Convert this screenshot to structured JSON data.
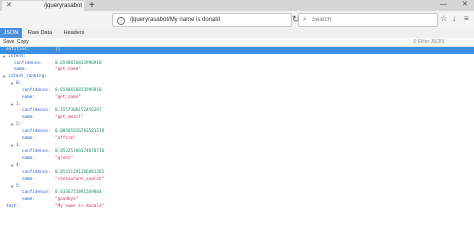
{
  "browser": {
    "tab_title": "/jqueryrasabot/",
    "url": "/jqueryrasabot/My name is donald",
    "search_placeholder": "Search"
  },
  "viewer": {
    "tabs": [
      "JSON",
      "Raw Data",
      "Headers"
    ],
    "save_label": "Save",
    "copy_label": "Copy",
    "filter_label": "Filter JSON"
  },
  "json_rows": [
    {
      "key": "entities:",
      "value": "[]",
      "indent": 0,
      "arrow": false,
      "type": "str",
      "selected": true
    },
    {
      "key": "intent:",
      "value": "",
      "indent": 0,
      "arrow": true,
      "type": "str"
    },
    {
      "key": "confidence:",
      "value": "0.6540656833996918",
      "indent": 1,
      "arrow": false,
      "type": "num"
    },
    {
      "key": "name:",
      "value": "\"get_name\"",
      "indent": 1,
      "arrow": false,
      "type": "str"
    },
    {
      "key": "intent_ranking:",
      "value": "",
      "indent": 0,
      "arrow": true,
      "type": "str"
    },
    {
      "key": "0:",
      "value": "",
      "indent": 1,
      "arrow": true,
      "type": "str"
    },
    {
      "key": "confidence:",
      "value": "0.6540656833996918",
      "indent": 2,
      "arrow": false,
      "type": "num"
    },
    {
      "key": "name:",
      "value": "\"get_name\"",
      "indent": 2,
      "arrow": false,
      "type": "str"
    },
    {
      "key": "1:",
      "value": "",
      "indent": 1,
      "arrow": true,
      "type": "str"
    },
    {
      "key": "confidence:",
      "value": "0.1557308152456367",
      "indent": 2,
      "arrow": false,
      "type": "num"
    },
    {
      "key": "name:",
      "value": "\"get_email\"",
      "indent": 2,
      "arrow": false,
      "type": "str"
    },
    {
      "key": "2:",
      "value": "",
      "indent": 1,
      "arrow": true,
      "type": "str"
    },
    {
      "key": "confidence:",
      "value": "0.08505326783581219",
      "indent": 2,
      "arrow": false,
      "type": "num"
    },
    {
      "key": "name:",
      "value": "\"affirm\"",
      "indent": 2,
      "arrow": false,
      "type": "str"
    },
    {
      "key": "3:",
      "value": "",
      "indent": 1,
      "arrow": true,
      "type": "str"
    },
    {
      "key": "confidence:",
      "value": "0.05325366574870736",
      "indent": 2,
      "arrow": false,
      "type": "num"
    },
    {
      "key": "name:",
      "value": "\"greet\"",
      "indent": 2,
      "arrow": false,
      "type": "str"
    },
    {
      "key": "4:",
      "value": "",
      "indent": 1,
      "arrow": true,
      "type": "str"
    },
    {
      "key": "confidence:",
      "value": "0.05411291206081261",
      "indent": 2,
      "arrow": false,
      "type": "num"
    },
    {
      "key": "name:",
      "value": "\"restaurant_search\"",
      "indent": 2,
      "arrow": false,
      "type": "str"
    },
    {
      "key": "5:",
      "value": "",
      "indent": 1,
      "arrow": true,
      "type": "str"
    },
    {
      "key": "confidence:",
      "value": "0.0336751891569864",
      "indent": 2,
      "arrow": false,
      "type": "num"
    },
    {
      "key": "name:",
      "value": "\"goodbye\"",
      "indent": 2,
      "arrow": false,
      "type": "str"
    },
    {
      "key": "text:",
      "value": "\"My name is donald\"",
      "indent": 0,
      "arrow": false,
      "type": "str"
    }
  ]
}
